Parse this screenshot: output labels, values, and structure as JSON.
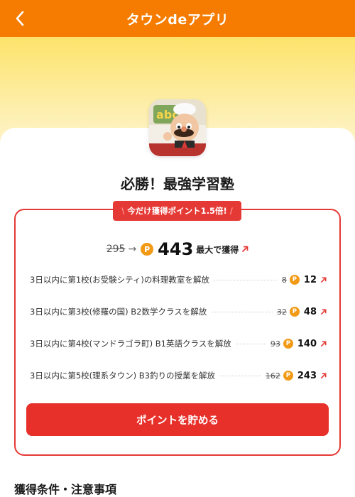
{
  "header": {
    "title": "タウンdeアプリ",
    "back_icon": "chevron-left-icon",
    "background_color": "#f57c00"
  },
  "app": {
    "name": "必勝！最強学習塾",
    "icon": "app-icon-cartoon-character"
  },
  "promo": {
    "badge_text": "今だけ獲得ポイント1.5倍!",
    "slash_left": "\\",
    "slash_right": "/"
  },
  "summary": {
    "old_points": "295",
    "arrow": "→",
    "coin_symbol": "P",
    "new_points": "443",
    "max_label": "最大で獲得"
  },
  "tasks": [
    {
      "text": "3日以内に第1校(お受験シティ)の料理教室を解放",
      "old_points": "8",
      "new_points": "12"
    },
    {
      "text": "3日以内に第3校(修羅の国) B2数学クラスを解放",
      "old_points": "32",
      "new_points": "48"
    },
    {
      "text": "3日以内に第4校(マンドラゴラ町) B1英語クラスを解放",
      "old_points": "93",
      "new_points": "140"
    },
    {
      "text": "3日以内に第5校(理系タウン) B3釣りの授業を解放",
      "old_points": "162",
      "new_points": "243"
    }
  ],
  "cta": {
    "label": "ポイントを貯める"
  },
  "conditions": {
    "title": "獲得条件・注意事項"
  },
  "colors": {
    "accent_red": "#e53935",
    "coin_orange": "#f29a16",
    "hero_yellow": "#fde36b"
  }
}
